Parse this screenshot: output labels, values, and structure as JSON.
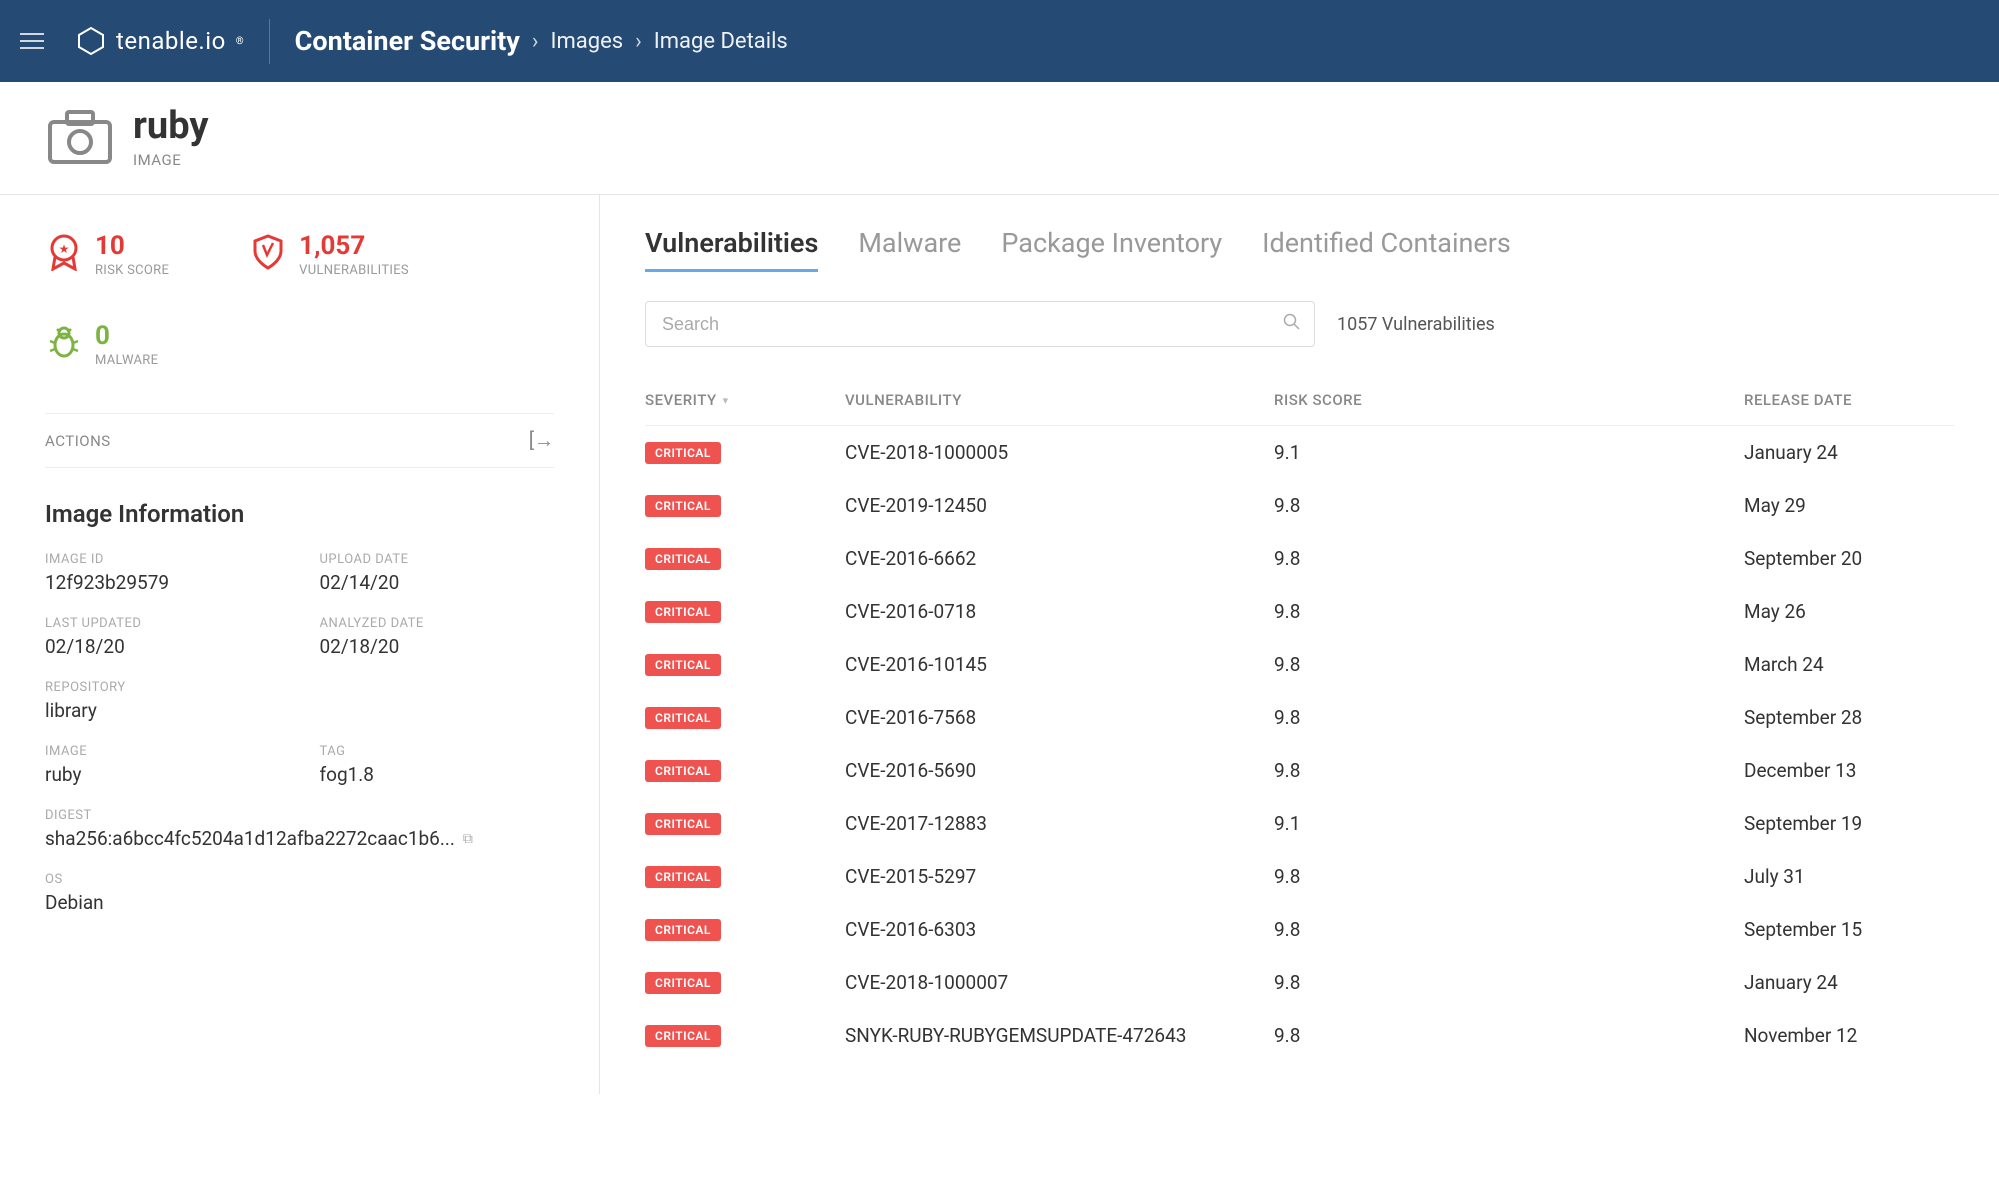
{
  "topbar": {
    "brand": "tenable.io",
    "breadcrumb": {
      "root": "Container Security",
      "mid": "Images",
      "current": "Image Details"
    }
  },
  "header": {
    "title": "ruby",
    "subtitle": "IMAGE"
  },
  "metrics": {
    "risk": {
      "value": "10",
      "label": "RISK SCORE"
    },
    "vuln": {
      "value": "1,057",
      "label": "VULNERABILITIES"
    },
    "malware": {
      "value": "0",
      "label": "MALWARE"
    }
  },
  "actions": {
    "label": "ACTIONS"
  },
  "info": {
    "title": "Image Information",
    "image_id": {
      "label": "IMAGE ID",
      "value": "12f923b29579"
    },
    "upload_date": {
      "label": "UPLOAD DATE",
      "value": "02/14/20"
    },
    "last_updated": {
      "label": "LAST UPDATED",
      "value": "02/18/20"
    },
    "analyzed_date": {
      "label": "ANALYZED DATE",
      "value": "02/18/20"
    },
    "repository": {
      "label": "REPOSITORY",
      "value": "library"
    },
    "image": {
      "label": "IMAGE",
      "value": "ruby"
    },
    "tag": {
      "label": "TAG",
      "value": "fog1.8"
    },
    "digest": {
      "label": "DIGEST",
      "value": "sha256:a6bcc4fc5204a1d12afba2272caac1b6..."
    },
    "os": {
      "label": "OS",
      "value": "Debian"
    }
  },
  "tabs": [
    "Vulnerabilities",
    "Malware",
    "Package Inventory",
    "Identified Containers"
  ],
  "search": {
    "placeholder": "Search"
  },
  "results_count": "1057 Vulnerabilities",
  "columns": {
    "severity": "SEVERITY",
    "vulnerability": "VULNERABILITY",
    "risk": "RISK SCORE",
    "date": "RELEASE DATE"
  },
  "rows": [
    {
      "severity": "CRITICAL",
      "vuln": "CVE-2018-1000005",
      "risk": "9.1",
      "date": "January 24"
    },
    {
      "severity": "CRITICAL",
      "vuln": "CVE-2019-12450",
      "risk": "9.8",
      "date": "May 29"
    },
    {
      "severity": "CRITICAL",
      "vuln": "CVE-2016-6662",
      "risk": "9.8",
      "date": "September 20"
    },
    {
      "severity": "CRITICAL",
      "vuln": "CVE-2016-0718",
      "risk": "9.8",
      "date": "May 26"
    },
    {
      "severity": "CRITICAL",
      "vuln": "CVE-2016-10145",
      "risk": "9.8",
      "date": "March 24"
    },
    {
      "severity": "CRITICAL",
      "vuln": "CVE-2016-7568",
      "risk": "9.8",
      "date": "September 28"
    },
    {
      "severity": "CRITICAL",
      "vuln": "CVE-2016-5690",
      "risk": "9.8",
      "date": "December 13"
    },
    {
      "severity": "CRITICAL",
      "vuln": "CVE-2017-12883",
      "risk": "9.1",
      "date": "September 19"
    },
    {
      "severity": "CRITICAL",
      "vuln": "CVE-2015-5297",
      "risk": "9.8",
      "date": "July 31"
    },
    {
      "severity": "CRITICAL",
      "vuln": "CVE-2016-6303",
      "risk": "9.8",
      "date": "September 15"
    },
    {
      "severity": "CRITICAL",
      "vuln": "CVE-2018-1000007",
      "risk": "9.8",
      "date": "January 24"
    },
    {
      "severity": "CRITICAL",
      "vuln": "SNYK-RUBY-RUBYGEMSUPDATE-472643",
      "risk": "9.8",
      "date": "November 12"
    }
  ]
}
